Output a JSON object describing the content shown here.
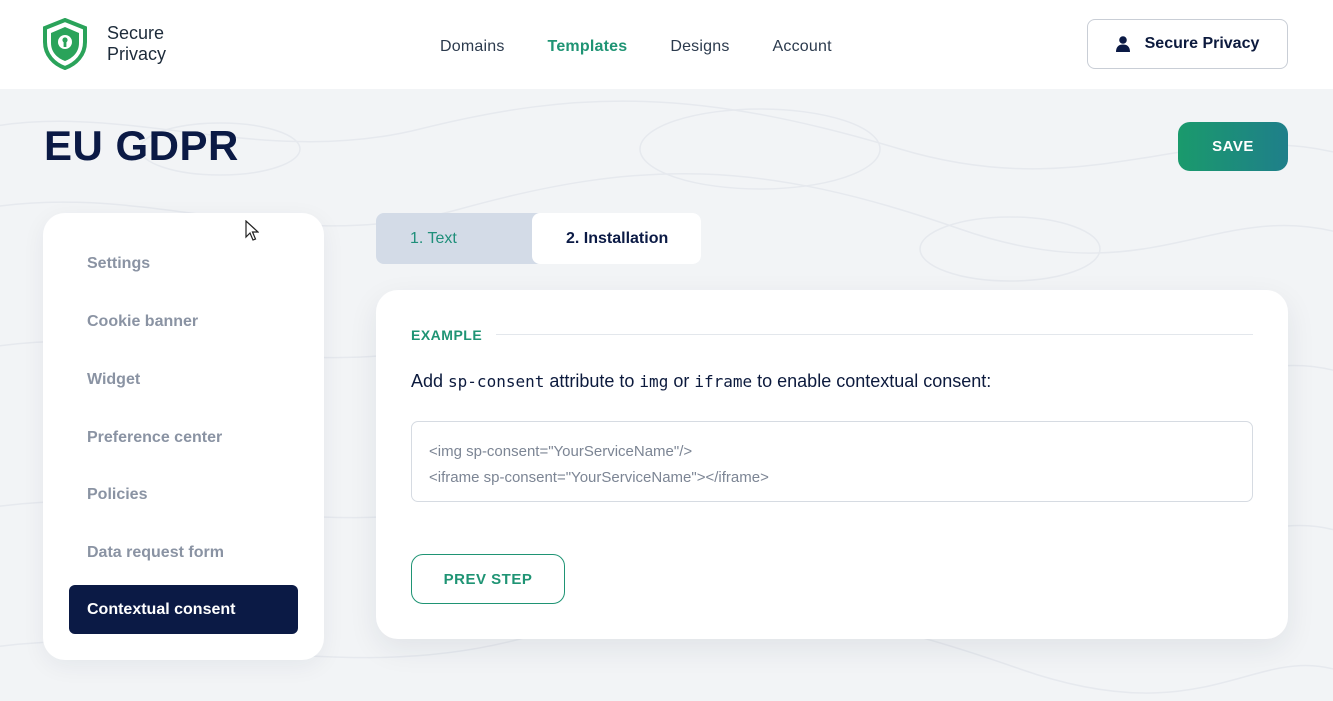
{
  "header": {
    "logo_line1": "Secure",
    "logo_line2": "Privacy",
    "nav": [
      {
        "label": "Domains",
        "active": false
      },
      {
        "label": "Templates",
        "active": true
      },
      {
        "label": "Designs",
        "active": false
      },
      {
        "label": "Account",
        "active": false
      }
    ],
    "account_label": "Secure Privacy",
    "account_icon": "user-icon"
  },
  "page": {
    "title": "EU GDPR",
    "save_label": "SAVE"
  },
  "sidebar": {
    "items": [
      {
        "label": "Settings",
        "active": false
      },
      {
        "label": "Cookie banner",
        "active": false
      },
      {
        "label": "Widget",
        "active": false
      },
      {
        "label": "Preference center",
        "active": false
      },
      {
        "label": "Policies",
        "active": false
      },
      {
        "label": "Data request form",
        "active": false
      },
      {
        "label": "Contextual consent",
        "active": true
      }
    ]
  },
  "tabs": [
    {
      "label": "1. Text",
      "active": false
    },
    {
      "label": "2. Installation",
      "active": true
    }
  ],
  "content": {
    "section_label": "EXAMPLE",
    "instruction": {
      "part1": "Add ",
      "code1": "sp-consent",
      "part2": " attribute to ",
      "code2": "img",
      "part3": " or ",
      "code3": "iframe",
      "part4": " to enable contextual consent:"
    },
    "code_lines": [
      "<img sp-consent=\"YourServiceName\"/>",
      "<iframe sp-consent=\"YourServiceName\"></iframe>"
    ],
    "prev_label": "PREV STEP"
  },
  "colors": {
    "brand_green": "#1f9474",
    "navy": "#0b1a45",
    "tab_bg": "#d3dbe7"
  }
}
